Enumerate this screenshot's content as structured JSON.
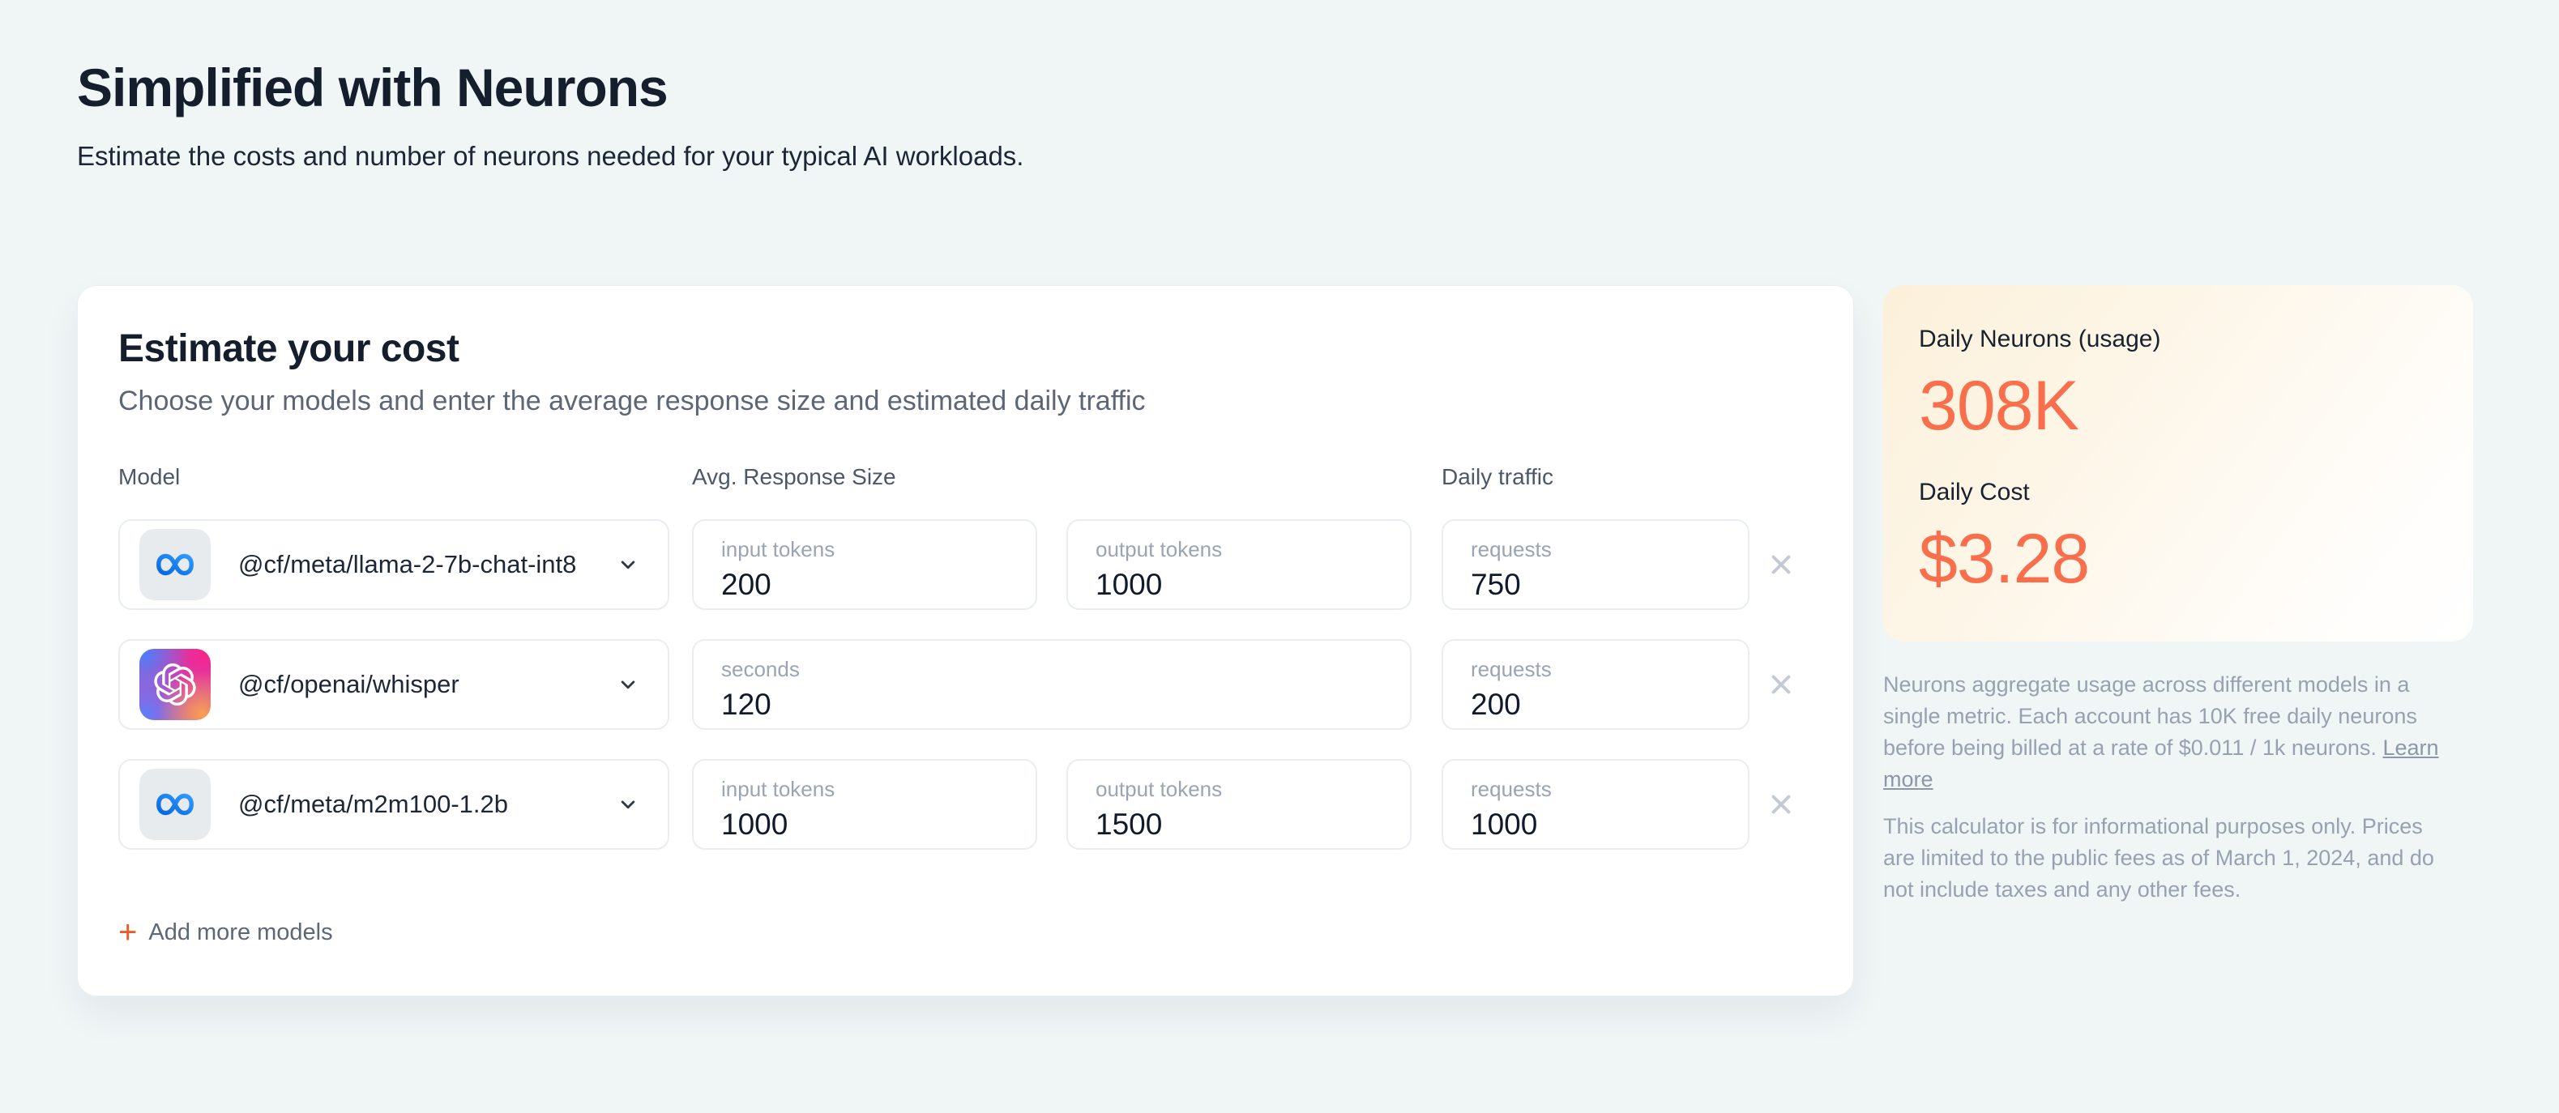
{
  "page": {
    "title": "Simplified with Neurons",
    "subtitle": "Estimate the costs and number of neurons needed for your typical AI workloads."
  },
  "calculator": {
    "title": "Estimate your cost",
    "subtitle": "Choose your models and enter the average response size and estimated daily traffic",
    "columns": {
      "model": "Model",
      "avg_response_size": "Avg. Response Size",
      "daily_traffic": "Daily traffic"
    },
    "rows": [
      {
        "model": "@cf/meta/llama-2-7b-chat-int8",
        "provider": "meta",
        "fields": [
          {
            "placeholder": "input tokens",
            "value": "200"
          },
          {
            "placeholder": "output tokens",
            "value": "1000"
          }
        ],
        "traffic": {
          "placeholder": "requests",
          "value": "750"
        }
      },
      {
        "model": "@cf/openai/whisper",
        "provider": "openai",
        "fields": [
          {
            "placeholder": "seconds",
            "value": "120"
          }
        ],
        "traffic": {
          "placeholder": "requests",
          "value": "200"
        }
      },
      {
        "model": "@cf/meta/m2m100-1.2b",
        "provider": "meta",
        "fields": [
          {
            "placeholder": "input tokens",
            "value": "1000"
          },
          {
            "placeholder": "output tokens",
            "value": "1500"
          }
        ],
        "traffic": {
          "placeholder": "requests",
          "value": "1000"
        }
      }
    ],
    "add_more_plus": "+",
    "add_more_label": "Add more models"
  },
  "summary": {
    "neurons_label": "Daily Neurons (usage)",
    "neurons_value": "308K",
    "cost_label": "Daily Cost",
    "cost_value": "$3.28",
    "note1": "Neurons aggregate usage across different models in a single metric. Each account has 10K free daily neurons before being billed at a rate of $0.011 / 1k neurons. ",
    "note1_link": "Learn more",
    "note2": "This calculator is for informational purposes only. Prices are limited to the public fees as of March 1, 2024, and do not include taxes and any other fees."
  },
  "icons": {
    "meta": "meta-infinity-icon",
    "openai": "openai-logo-icon",
    "chevron": "chevron-down-icon",
    "remove": "x-icon",
    "add": "plus-icon"
  },
  "colors": {
    "page_bg": "#f0f5f6",
    "accent_orange": "#f96f4c",
    "plus_orange": "#f05a26",
    "meta_blue_start": "#0668e1",
    "meta_blue_end": "#2f9bff",
    "panel_gradient_start": "#fcf0da"
  }
}
